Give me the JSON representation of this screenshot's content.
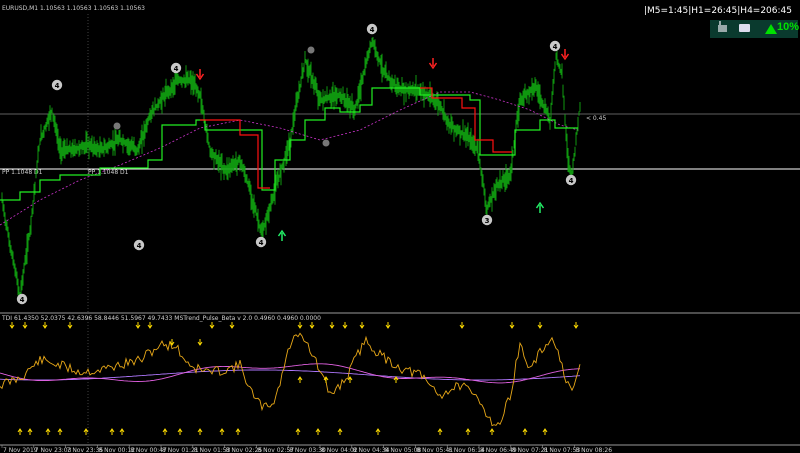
{
  "symbol_header": "EURUSD,M1  1.10563 1.10563 1.10563 1.10563",
  "status_text": "|M5=1:45|H1=26:45|H4=206:45",
  "strength_percent": "10%",
  "icons": [
    "factory-icon",
    "briefcase-icon",
    "up-triangle-icon"
  ],
  "pp_label_left": "PP 1.1048 D1",
  "pp_label_mid": "PP 1.1048 D1",
  "price_label": "< 0.45",
  "indicator_header": "TDI 61.4350 52.0375 42.6396 58.8446 51.5967 49.7433  MSTrend_Pulse_Beta v 2.0  0.4960 0.4960 0.0000",
  "time_labels": [
    "7 Nov 2019",
    "7 Nov 23:03",
    "7 Nov 23:35",
    "8 Nov 00:12",
    "8 Nov 00:47",
    "8 Nov 01:21",
    "8 Nov 01:53",
    "8 Nov 02:25",
    "8 Nov 02:57",
    "8 Nov 03:30",
    "8 Nov 04:02",
    "8 Nov 04:34",
    "8 Nov 05:08",
    "8 Nov 05:41",
    "8 Nov 06:14",
    "8 Nov 06:49",
    "8 Nov 07:21",
    "8 Nov 07:53",
    "8 Nov 08:26"
  ],
  "wave_markers": [
    "4",
    "4",
    "4",
    "3",
    "4",
    "4",
    "3",
    "4",
    "4",
    "3",
    "4",
    "4",
    "4",
    "4"
  ],
  "colors": {
    "price": "#11a811",
    "support": "#22ee22",
    "resistance": "#ff1111",
    "ma": "#cc33cc",
    "tdi": "#e8a818",
    "tdi_ma": "#e060e0",
    "tdi_ma2": "#b078ff",
    "arrow_up": "#22ee66",
    "arrow_down": "#ff2222",
    "yellow_arrow": "#ffdd00"
  }
}
